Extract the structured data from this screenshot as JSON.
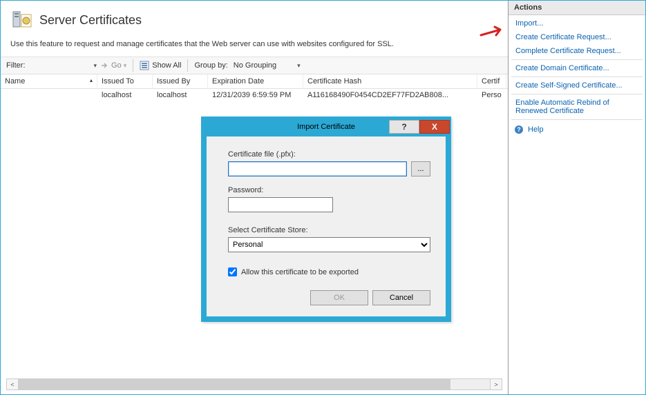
{
  "header": {
    "title": "Server Certificates",
    "subtitle": "Use this feature to request and manage certificates that the Web server can use with websites configured for SSL."
  },
  "toolbar": {
    "filter_label": "Filter:",
    "go_label": "Go",
    "showall_label": "Show All",
    "groupby_label": "Group by:",
    "groupby_value": "No Grouping"
  },
  "grid": {
    "columns": {
      "name": "Name",
      "issued_to": "Issued To",
      "issued_by": "Issued By",
      "expiration": "Expiration Date",
      "hash": "Certificate Hash",
      "store": "Certif"
    },
    "rows": [
      {
        "name": "",
        "issued_to": "localhost",
        "issued_by": "localhost",
        "expiration": "12/31/2039 6:59:59 PM",
        "hash": "A116168490F0454CD2EF77FD2AB808...",
        "store": "Perso"
      }
    ]
  },
  "actions": {
    "title": "Actions",
    "items": [
      "Import...",
      "Create Certificate Request...",
      "Complete Certificate Request...",
      "Create Domain Certificate...",
      "Create Self-Signed Certificate...",
      "Enable Automatic Rebind of Renewed Certificate"
    ],
    "help": "Help"
  },
  "dialog": {
    "title": "Import Certificate",
    "file_label": "Certificate file (.pfx):",
    "browse": "...",
    "password_label": "Password:",
    "store_label": "Select Certificate Store:",
    "store_value": "Personal",
    "allow_export": "Allow this certificate to be exported",
    "ok": "OK",
    "cancel": "Cancel",
    "help_btn": "?",
    "close_btn": "X"
  }
}
